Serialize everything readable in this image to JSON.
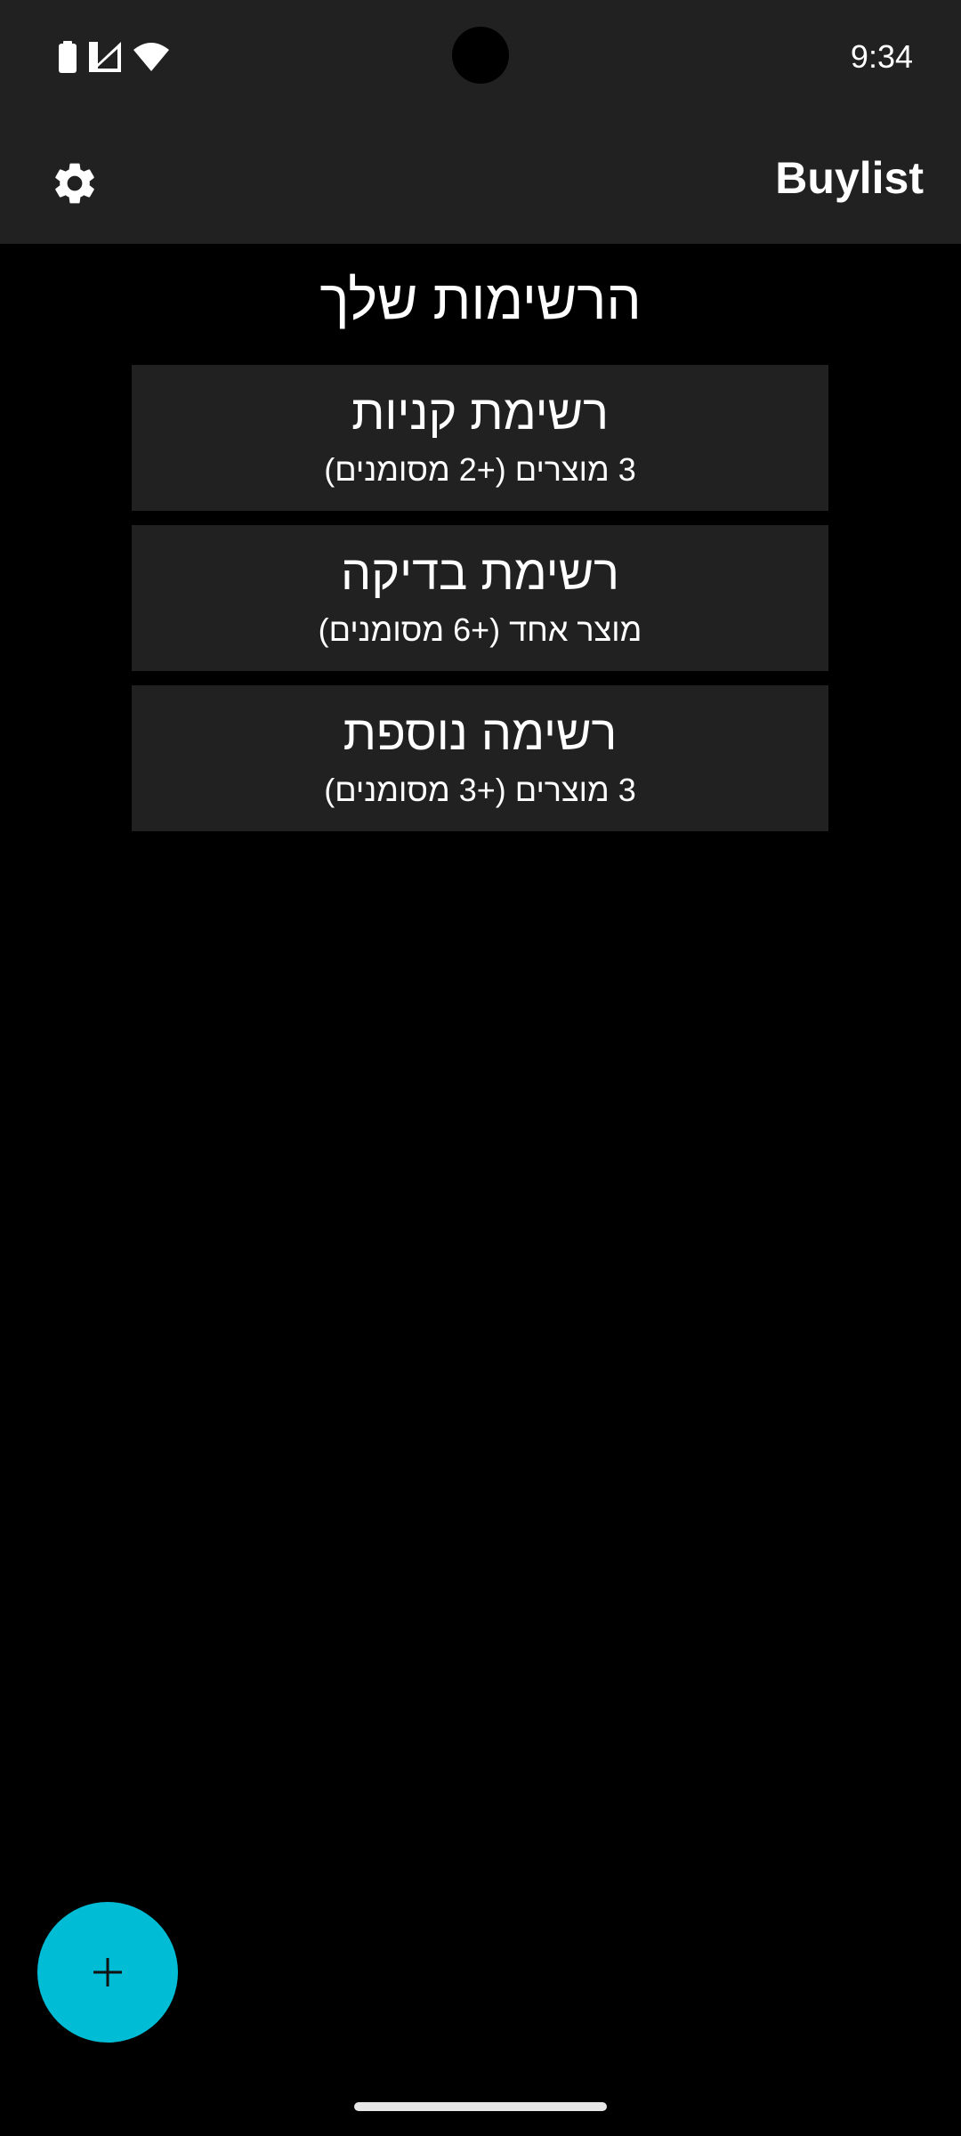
{
  "status_bar": {
    "time": "9:34",
    "icons": [
      "battery-icon",
      "cell-signal-icon",
      "wifi-icon"
    ]
  },
  "app_bar": {
    "title": "Buylist",
    "settings_icon": "gear-icon"
  },
  "main": {
    "title": "הרשימות שלך",
    "lists": [
      {
        "name": "רשימת קניות",
        "summary": "3 מוצרים (+2 מסומנים)"
      },
      {
        "name": "רשימת בדיקה",
        "summary": "מוצר אחד (+6 מסומנים)"
      },
      {
        "name": "רשימה נוספת",
        "summary": "3 מוצרים (+3 מסומנים)"
      }
    ]
  },
  "fab": {
    "icon": "plus-icon",
    "color": "#00bcd4"
  },
  "colors": {
    "background": "#000000",
    "surface": "#212121",
    "accent": "#00bcd4",
    "text": "#ffffff"
  }
}
